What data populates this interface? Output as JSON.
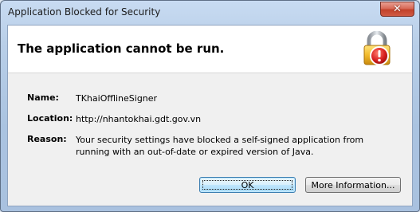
{
  "window": {
    "title": "Application Blocked for Security",
    "close_glyph": "✕"
  },
  "header": {
    "headline": "The application cannot be run.",
    "icon": "padlock-warning-icon"
  },
  "details": [
    {
      "label": "Name:",
      "value": "TKhaiOfflineSigner"
    },
    {
      "label": "Location:",
      "value": "http://nhantokhai.gdt.gov.vn"
    },
    {
      "label": "Reason:",
      "value": "Your security settings have blocked a self-signed application from running with an out-of-date or expired version of Java."
    }
  ],
  "buttons": {
    "ok": "OK",
    "more_info": "More Information..."
  },
  "colors": {
    "close_button": "#c2412b",
    "lock_body": "#e0a720",
    "warning_badge": "#d21f1f"
  }
}
